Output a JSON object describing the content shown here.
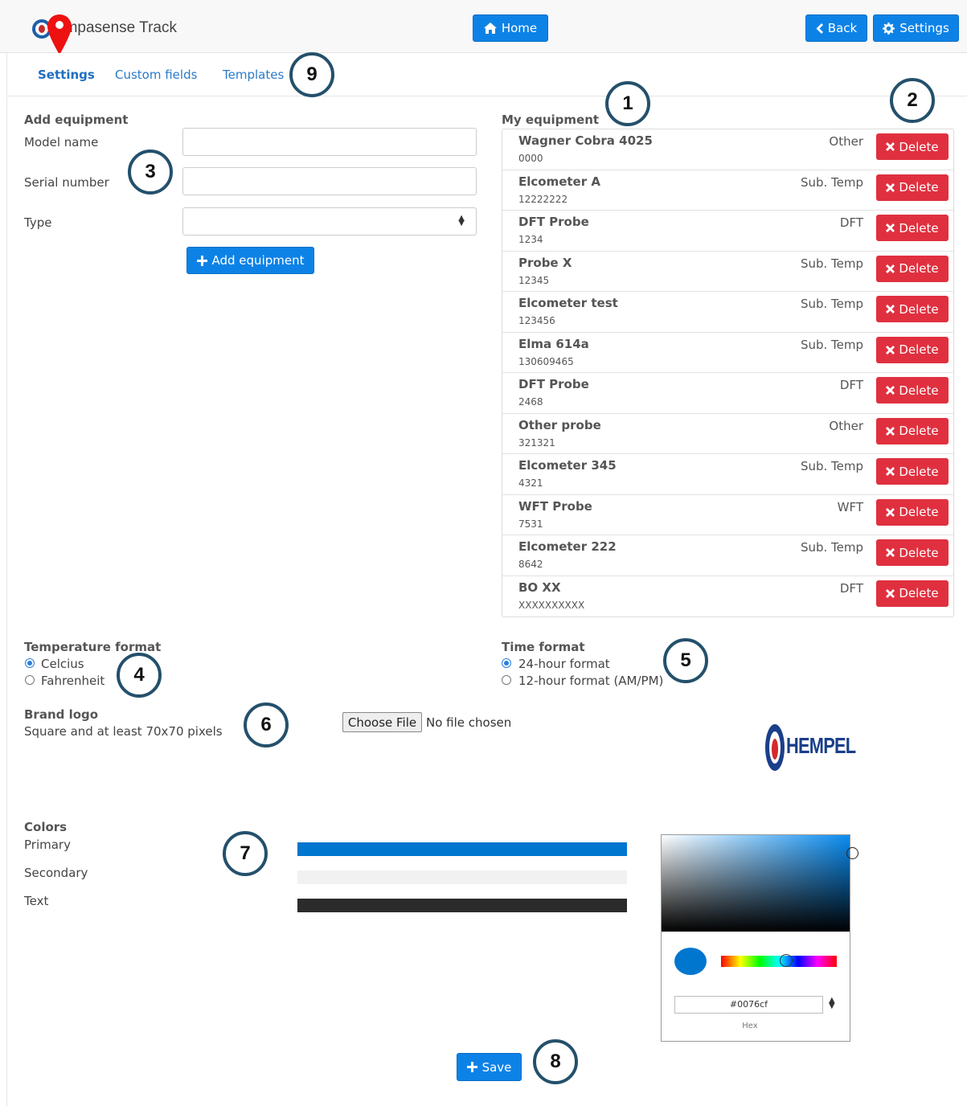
{
  "app": {
    "title": "Hempasense Track",
    "visible_title": "empasense Track"
  },
  "header": {
    "home_label": "Home",
    "back_label": "Back",
    "settings_label": "Settings"
  },
  "tabs": [
    {
      "label": "Settings",
      "active": true
    },
    {
      "label": "Custom fields",
      "active": false
    },
    {
      "label": "Templates",
      "active": false
    }
  ],
  "add_equipment": {
    "title": "Add equipment",
    "model_name_label": "Model name",
    "serial_number_label": "Serial number",
    "type_label": "Type",
    "model_name_value": "",
    "serial_number_value": "",
    "type_value": "",
    "button_label": "Add equipment"
  },
  "my_equipment": {
    "title": "My equipment",
    "delete_label": "Delete",
    "items": [
      {
        "name": "Wagner Cobra 4025",
        "serial": "0000",
        "type": "Other"
      },
      {
        "name": "Elcometer A",
        "serial": "12222222",
        "type": "Sub. Temp"
      },
      {
        "name": "DFT Probe",
        "serial": "1234",
        "type": "DFT"
      },
      {
        "name": "Probe X",
        "serial": "12345",
        "type": "Sub. Temp"
      },
      {
        "name": "Elcometer test",
        "serial": "123456",
        "type": "Sub. Temp"
      },
      {
        "name": "Elma 614a",
        "serial": "130609465",
        "type": "Sub. Temp"
      },
      {
        "name": "DFT Probe",
        "serial": "2468",
        "type": "DFT"
      },
      {
        "name": "Other probe",
        "serial": "321321",
        "type": "Other"
      },
      {
        "name": "Elcometer 345",
        "serial": "4321",
        "type": "Sub. Temp"
      },
      {
        "name": "WFT Probe",
        "serial": "7531",
        "type": "WFT"
      },
      {
        "name": "Elcometer 222",
        "serial": "8642",
        "type": "Sub. Temp"
      },
      {
        "name": "BO XX",
        "serial": "XXXXXXXXXX",
        "type": "DFT"
      }
    ]
  },
  "temperature": {
    "title": "Temperature format",
    "options": [
      "Celcius",
      "Fahrenheit"
    ],
    "selected": "Celcius"
  },
  "time_format": {
    "title": "Time format",
    "options": [
      "24-hour format",
      "12-hour format (AM/PM)"
    ],
    "selected": "24-hour format"
  },
  "brand_logo": {
    "title": "Brand logo",
    "hint": "Square and at least 70x70 pixels",
    "choose_file_label": "Choose File",
    "no_file_label": "No file chosen",
    "logo_text": "HEMPEL"
  },
  "colors": {
    "title": "Colors",
    "primary_label": "Primary",
    "secondary_label": "Secondary",
    "text_label": "Text",
    "primary": "#0076cf",
    "secondary": "#f1f1f1",
    "text": "#2b2b2b"
  },
  "color_picker": {
    "hex_value": "#0076cf",
    "hex_label": "Hex"
  },
  "save_label": "Save",
  "callouts": [
    "1",
    "2",
    "3",
    "4",
    "5",
    "6",
    "7",
    "8",
    "9"
  ]
}
